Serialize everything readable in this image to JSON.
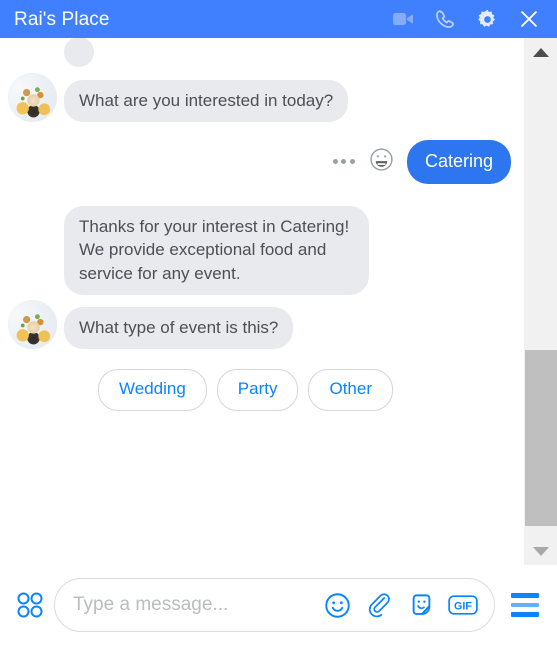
{
  "header": {
    "title": "Rai's Place",
    "icons": [
      {
        "name": "video-call-icon",
        "label": "Video call"
      },
      {
        "name": "voice-call-icon",
        "label": "Voice call"
      },
      {
        "name": "settings-gear-icon",
        "label": "Settings"
      },
      {
        "name": "close-icon",
        "label": "Close"
      }
    ],
    "background_color": "#4080ff",
    "title_color": "#ffffff"
  },
  "conversation": {
    "messages": [
      {
        "id": "msg-clipped",
        "sender": "bot",
        "text": "",
        "clipped": true
      },
      {
        "id": "msg-interest",
        "sender": "bot",
        "text": "What are you interested in today?"
      },
      {
        "id": "msg-catering",
        "sender": "user",
        "text": "Catering"
      },
      {
        "id": "msg-thanks",
        "sender": "bot",
        "text": "Thanks for your interest in Catering!  We provide exceptional food and service for any event."
      },
      {
        "id": "msg-event-type",
        "sender": "bot",
        "text": "What type of event is this?"
      }
    ],
    "quick_replies": [
      {
        "label": "Wedding"
      },
      {
        "label": "Party"
      },
      {
        "label": "Other"
      }
    ],
    "bubble_colors": {
      "bot_background": "#e9eaed",
      "bot_text": "#4b4f56",
      "user_background": "#2d76f0",
      "user_text": "#ffffff",
      "quick_reply_text": "#0a84ff",
      "quick_reply_border": "#d3d6db"
    }
  },
  "scrollbar": {
    "up_arrow": "scroll-up-arrow",
    "down_arrow": "scroll-down-arrow",
    "track_color": "#f1f1f1",
    "thumb_color": "#bfbfbf"
  },
  "composer": {
    "apps_grid": "apps-grid-icon",
    "placeholder": "Type a message...",
    "value": "",
    "icons": [
      {
        "name": "emoji-icon",
        "label": "Emoji"
      },
      {
        "name": "attachment-paperclip-icon",
        "label": "Attach file"
      },
      {
        "name": "sticker-icon",
        "label": "Stickers"
      },
      {
        "name": "gif-icon",
        "label": "GIF"
      }
    ],
    "gif_label": "GIF",
    "menu": "hamburger-menu-icon",
    "accent_color": "#0a84ff"
  }
}
